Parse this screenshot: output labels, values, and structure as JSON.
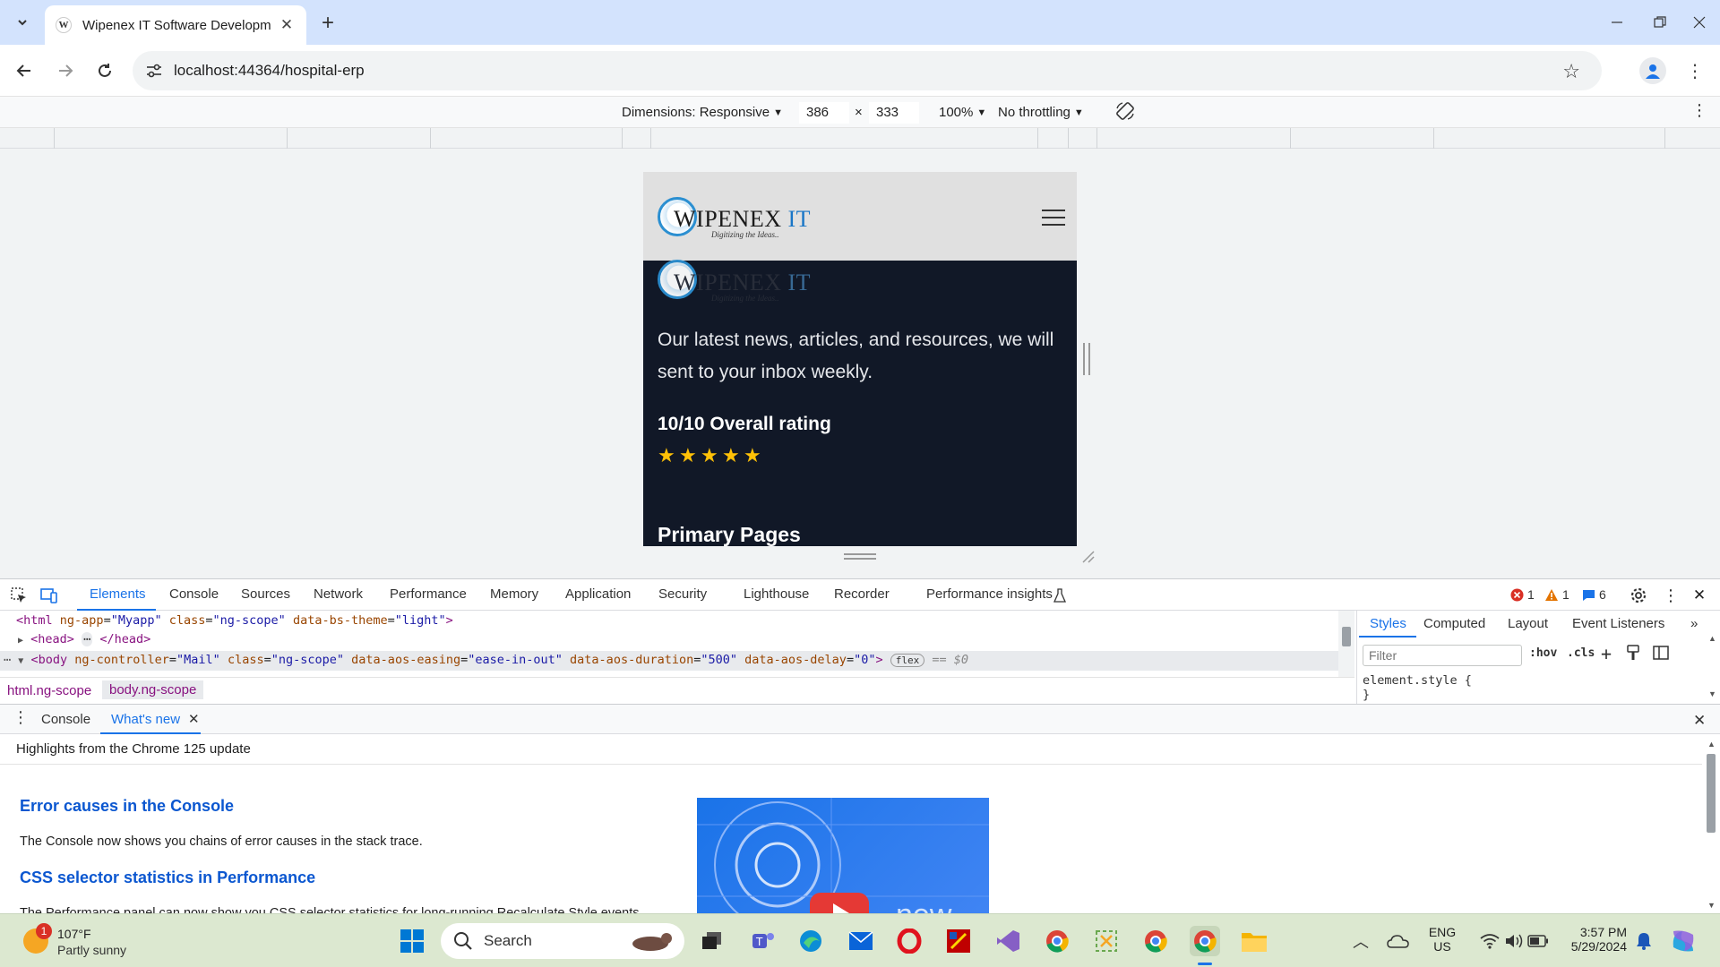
{
  "browser": {
    "tab_title": "Wipenex IT Software Developm",
    "tab_favicon": "W",
    "url": "localhost:44364/hospital-erp"
  },
  "device_toolbar": {
    "dimensions_label": "Dimensions: Responsive",
    "width": "386",
    "times": "×",
    "height": "333",
    "zoom": "100%",
    "throttling": "No throttling"
  },
  "site": {
    "logo_text": "WIPENEX",
    "logo_it": "IT",
    "logo_tagline": "Digitizing the Ideas..",
    "news_text": "Our latest news, articles, and resources, we will sent to your inbox weekly.",
    "rating_title": "10/10 Overall rating",
    "stars": 5,
    "primary_pages": "Primary Pages"
  },
  "devtools": {
    "tabs": [
      "Elements",
      "Console",
      "Sources",
      "Network",
      "Performance",
      "Memory",
      "Application",
      "Security",
      "Lighthouse",
      "Recorder",
      "Performance insights"
    ],
    "errors": "1",
    "warnings": "1",
    "messages": "6",
    "code": {
      "html_tag": "<html",
      "html_attrs": [
        {
          "name": "ng-app",
          "value": "\"Myapp\""
        },
        {
          "name": "class",
          "value": "\"ng-scope\""
        },
        {
          "name": "data-bs-theme",
          "value": "\"light\""
        }
      ],
      "html_close": ">",
      "head": "<head>",
      "head_dots": "⋯",
      "head_close": "</head>",
      "body_tag": "<body",
      "body_attrs": [
        {
          "name": "ng-controller",
          "value": "\"Mail\""
        },
        {
          "name": "class",
          "value": "\"ng-scope\""
        },
        {
          "name": "data-aos-easing",
          "value": "\"ease-in-out\""
        },
        {
          "name": "data-aos-duration",
          "value": "\"500\""
        },
        {
          "name": "data-aos-delay",
          "value": "\"0\""
        }
      ],
      "body_close": ">",
      "flex_badge": "flex",
      "dollar0": "== $0"
    },
    "breadcrumbs": [
      "html.ng-scope",
      "body.ng-scope"
    ],
    "styles_tabs": [
      "Styles",
      "Computed",
      "Layout",
      "Event Listeners"
    ],
    "filter_placeholder": "Filter",
    "hov": ":hov",
    "cls": ".cls",
    "element_style": "element.style {",
    "element_style_close": "}"
  },
  "drawer": {
    "tabs": [
      "Console",
      "What's new"
    ],
    "highlights": "Highlights from the Chrome 125 update",
    "h1": "Error causes in the Console",
    "p1": "The Console now shows you chains of error causes in the stack trace.",
    "h2": "CSS selector statistics in Performance",
    "p2": "The Performance panel can now show you CSS selector statistics for long-running Recalculate Style events.",
    "video_text": "new"
  },
  "taskbar": {
    "weather_temp": "107°F",
    "weather_desc": "Partly sunny",
    "weather_badge": "1",
    "search_label": "Search",
    "lang_1": "ENG",
    "lang_2": "US",
    "time": "3:57 PM",
    "date": "5/29/2024"
  }
}
